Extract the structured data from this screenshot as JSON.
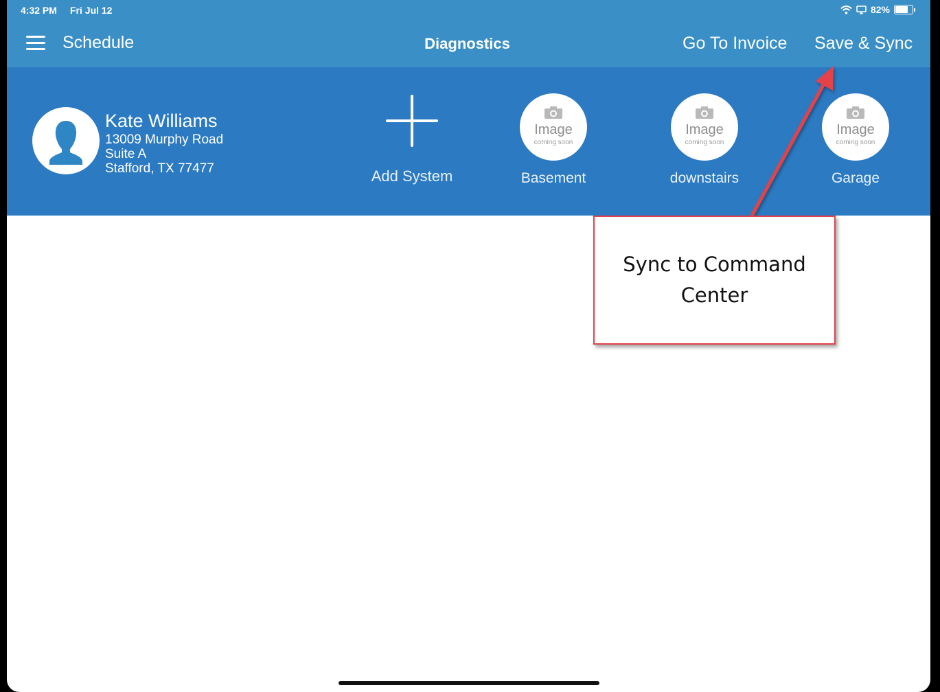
{
  "status_bar": {
    "time": "4:32 PM",
    "date": "Fri Jul 12",
    "battery": "82%",
    "battery_level": 0.82
  },
  "nav": {
    "schedule_label": "Schedule",
    "title": "Diagnostics",
    "invoice_label": "Go To Invoice",
    "save_label": "Save & Sync"
  },
  "customer": {
    "name": "Kate Williams",
    "address_line1": "13009 Murphy Road",
    "address_line2": "Suite A",
    "address_line3": "Stafford, TX 77477"
  },
  "add_system": {
    "label": "Add System"
  },
  "systems": [
    {
      "name": "Basement",
      "image_text": "Image",
      "image_subtext": "coming soon"
    },
    {
      "name": "downstairs",
      "image_text": "Image",
      "image_subtext": "coming soon"
    },
    {
      "name": "Garage",
      "image_text": "Image",
      "image_subtext": "coming soon"
    }
  ],
  "callout": {
    "text": "Sync to Command Center"
  },
  "colors": {
    "header": "#3a8fc6",
    "band": "#2b7ac2",
    "callout_border": "#e44249"
  },
  "icons": [
    "menu-icon",
    "wifi-icon",
    "screen-mirror-icon",
    "battery-icon",
    "avatar-icon",
    "plus-icon",
    "camera-icon"
  ]
}
